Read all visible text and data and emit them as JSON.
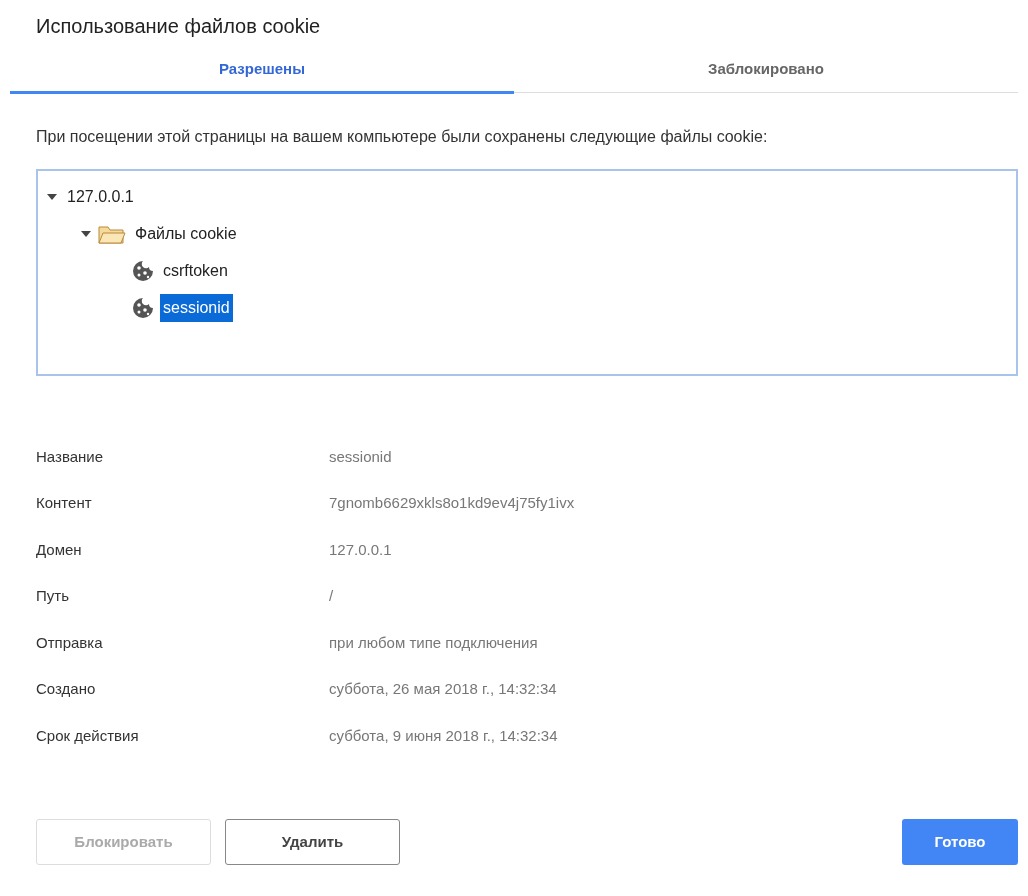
{
  "window": {
    "title": "Использование файлов cookie"
  },
  "tabs": [
    {
      "label": "Разрешены",
      "selected": true
    },
    {
      "label": "Заблокировано",
      "selected": false
    }
  ],
  "description": "При посещении этой страницы на вашем компьютере были сохранены следующие файлы cookie:",
  "tree": [
    {
      "label": "127.0.0.1",
      "kind": "host",
      "expanded": true,
      "selected": false,
      "children": [
        {
          "label": "Файлы cookie",
          "kind": "folder",
          "expanded": true,
          "selected": false,
          "children": [
            {
              "label": "csrftoken",
              "kind": "cookie",
              "selected": false
            },
            {
              "label": "sessionid",
              "kind": "cookie",
              "selected": true
            }
          ]
        }
      ]
    }
  ],
  "details": [
    {
      "label": "Название",
      "value": "sessionid"
    },
    {
      "label": "Контент",
      "value": "7gnomb6629xkls8o1kd9ev4j75fy1ivx"
    },
    {
      "label": "Домен",
      "value": "127.0.0.1"
    },
    {
      "label": "Путь",
      "value": "/"
    },
    {
      "label": "Отправка",
      "value": "при любом типе подключения"
    },
    {
      "label": "Создано",
      "value": "суббота, 26 мая 2018 г., 14:32:34"
    },
    {
      "label": "Срок действия",
      "value": "суббота, 9 июня 2018 г., 14:32:34"
    }
  ],
  "buttons": [
    {
      "label": "Блокировать",
      "kind": "default",
      "disabled": true
    },
    {
      "label": "Удалить",
      "kind": "default",
      "disabled": false
    },
    {
      "label": "Готово",
      "kind": "primary",
      "disabled": false
    }
  ]
}
